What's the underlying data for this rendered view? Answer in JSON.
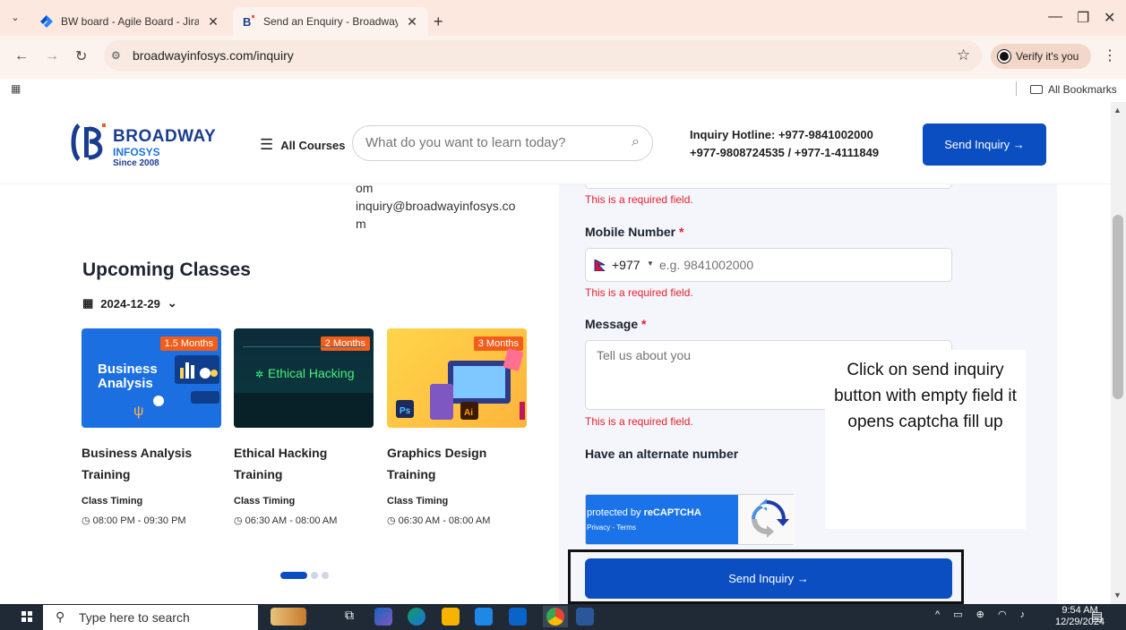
{
  "browser": {
    "tabs": [
      {
        "title": "BW board - Agile Board - Jira",
        "active": false
      },
      {
        "title": "Send an Enquiry - Broadway Inf",
        "active": true
      }
    ],
    "url": "broadwayinfosys.com/inquiry",
    "profile_label": "Verify it's you",
    "bookmarks_label": "All Bookmarks",
    "accent_color": "#fce8de"
  },
  "header": {
    "brand_name": "BROADWAY",
    "brand_sub": "INFOSYS",
    "brand_since": "Since 2008",
    "all_courses": "All Courses",
    "search_placeholder": "What do you want to learn today?",
    "hotline_line1": "Inquiry Hotline: +977-9841002000",
    "hotline_line2": "+977-9808724535  / +977-1-4111849",
    "cta_label": "Send Inquiry →",
    "brand_color": "#0b4ec2"
  },
  "contact": {
    "email_line1": "om",
    "email_line2": "inquiry@broadwayinfosys.co",
    "email_line3": "m"
  },
  "upcoming": {
    "heading": "Upcoming Classes",
    "date": "2024-12-29",
    "courses": [
      {
        "duration": "1.5 Months",
        "thumb_text": "Business Analysis",
        "title_line1": "Business Analysis",
        "title_line2": "Training",
        "timing_label": "Class Timing",
        "time": "08:00 PM - 09:30 PM"
      },
      {
        "duration": "2 Months",
        "thumb_text": "Ethical Hacking",
        "title_line1": "Ethical Hacking",
        "title_line2": "Training",
        "timing_label": "Class Timing",
        "time": "06:30 AM - 08:00 AM"
      },
      {
        "duration": "3 Months",
        "thumb_text": "",
        "title_line1": "Graphics Design",
        "title_line2": "Training",
        "timing_label": "Class Timing",
        "time": "06:30 AM - 08:00 AM"
      }
    ]
  },
  "form": {
    "error_text": "This is a required field.",
    "mobile_label": "Mobile Number",
    "country_code": "+977",
    "mobile_placeholder": "e.g. 9841002000",
    "message_label": "Message",
    "message_placeholder": "Tell us about you",
    "alternate_label": "Have an alternate number",
    "required_mark": "*",
    "captcha_line1_prefix": "protected by ",
    "captcha_line1_brand": "reCAPTCHA",
    "captcha_line2": "Privacy - Terms",
    "submit_label": "Send Inquiry →"
  },
  "annotation": {
    "note": "Click on send inquiry button with empty field it opens captcha fill up"
  },
  "taskbar": {
    "search_placeholder": "Type here to search",
    "time": "9:54 AM",
    "date": "12/29/2024"
  }
}
